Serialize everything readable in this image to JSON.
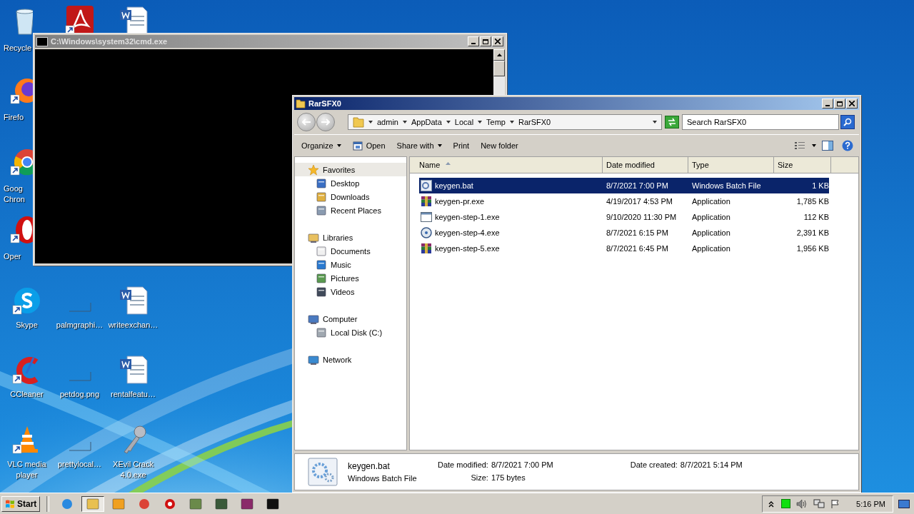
{
  "desktop": {
    "icons": [
      {
        "kind": "recycle",
        "label": "Recycle",
        "shortcut": false
      },
      {
        "kind": "pdf",
        "shortcut": true
      },
      {
        "kind": "word",
        "shortcut": false
      },
      {
        "kind": "firefox",
        "label": "Firefo",
        "shortcut": true
      },
      {
        "kind": "chrome",
        "label": "Goog Chron",
        "shortcut": true
      },
      {
        "kind": "opera",
        "label": "Oper",
        "shortcut": true
      },
      {
        "kind": "skype",
        "label": "Skype",
        "shortcut": true
      },
      {
        "label": "palmgraphi…",
        "shortcut": false
      },
      {
        "kind": "word",
        "label": "writeexchan…",
        "shortcut": false
      },
      {
        "kind": "ccleaner",
        "label": "CCleaner",
        "shortcut": true
      },
      {
        "label": "petdog.png",
        "shortcut": false
      },
      {
        "kind": "word",
        "label": "rentalfeatu…",
        "shortcut": false
      },
      {
        "kind": "vlc",
        "label": "VLC media player",
        "shortcut": true
      },
      {
        "label": "prettylocal…",
        "shortcut": false
      },
      {
        "kind": "key",
        "label": "XEvil Crack 4.0.exe",
        "shortcut": false
      }
    ]
  },
  "cmd_window": {
    "title": "C:\\Windows\\system32\\cmd.exe"
  },
  "explorer": {
    "title": "RarSFX0",
    "breadcrumb": [
      "admin",
      "AppData",
      "Local",
      "Temp",
      "RarSFX0"
    ],
    "search": {
      "placeholder": "Search RarSFX0"
    },
    "toolbar": [
      {
        "label": "Organize",
        "kind": "menu"
      },
      {
        "label": "Open",
        "kind": "open"
      },
      {
        "label": "Share with",
        "kind": "menu"
      },
      {
        "label": "Print",
        "kind": "plain"
      },
      {
        "label": "New folder",
        "kind": "plain"
      }
    ],
    "nav": [
      {
        "label": "Favorites",
        "kind": "star",
        "selected": true,
        "children": [
          {
            "label": "Desktop",
            "kind": "desktop",
            "selected": false
          },
          {
            "label": "Downloads",
            "kind": "downloads",
            "selected": false
          },
          {
            "label": "Recent Places",
            "kind": "recent",
            "selected": false
          }
        ]
      },
      {
        "label": "Libraries",
        "kind": "library",
        "selected": false,
        "children": [
          {
            "label": "Documents",
            "kind": "documents",
            "selected": false
          },
          {
            "label": "Music",
            "kind": "music",
            "selected": false
          },
          {
            "label": "Pictures",
            "kind": "pictures",
            "selected": false
          },
          {
            "label": "Videos",
            "kind": "videos",
            "selected": false
          }
        ]
      },
      {
        "label": "Computer",
        "kind": "computer",
        "selected": false,
        "children": [
          {
            "label": "Local Disk (C:)",
            "kind": "disk",
            "selected": false
          }
        ]
      },
      {
        "label": "Network",
        "kind": "network",
        "selected": false
      }
    ],
    "columns": [
      "Name",
      "Date modified",
      "Type",
      "Size"
    ],
    "files": [
      {
        "name": "keygen.bat",
        "kind": "bat",
        "date": "8/7/2021 7:00 PM",
        "type": "Windows Batch File",
        "size": "1 KB",
        "selected": true
      },
      {
        "name": "keygen-pr.exe",
        "kind": "rar",
        "date": "4/19/2017 4:53 PM",
        "type": "Application",
        "size": "1,785 KB",
        "selected": false
      },
      {
        "name": "keygen-step-1.exe",
        "kind": "window",
        "date": "9/10/2020 11:30 PM",
        "type": "Application",
        "size": "112 KB",
        "selected": false
      },
      {
        "name": "keygen-step-4.exe",
        "kind": "disc",
        "date": "8/7/2021 6:15 PM",
        "type": "Application",
        "size": "2,391 KB",
        "selected": false
      },
      {
        "name": "keygen-step-5.exe",
        "kind": "rar",
        "date": "8/7/2021 6:45 PM",
        "type": "Application",
        "size": "1,956 KB",
        "selected": false
      }
    ],
    "details": {
      "name": "keygen.bat",
      "type": "Windows Batch File",
      "fields": [
        {
          "label": "Date modified:",
          "value": "8/7/2021 7:00 PM"
        },
        {
          "label": "Date created:",
          "value": "8/7/2021 5:14 PM"
        },
        {
          "label": "Size:",
          "value": "175 bytes"
        }
      ]
    }
  },
  "taskbar": {
    "start": "Start",
    "buttons": [
      {
        "kind": "ie",
        "selected": false
      },
      {
        "kind": "explorer",
        "selected": true
      },
      {
        "kind": "media",
        "selected": false
      },
      {
        "kind": "chrome",
        "selected": false
      },
      {
        "kind": "opera",
        "selected": false
      },
      {
        "kind": "tool",
        "selected": false
      },
      {
        "kind": "monitor",
        "selected": false
      },
      {
        "kind": "rar",
        "selected": false
      },
      {
        "kind": "cmd",
        "selected": false
      }
    ],
    "clock": "5:16 PM"
  }
}
